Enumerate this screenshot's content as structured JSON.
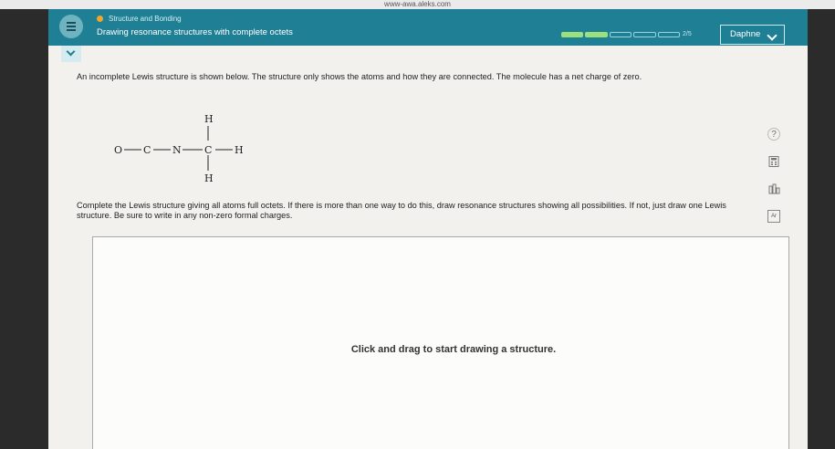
{
  "browser": {
    "url": "www-awa.aleks.com"
  },
  "header": {
    "topic": "Structure and Bonding",
    "lesson": "Drawing resonance structures with complete octets",
    "progress_label": "2/5",
    "progress": {
      "completed": 2,
      "total": 5
    },
    "user_name": "Daphne",
    "accent_color": "#1f7f95"
  },
  "question": {
    "prompt": "An incomplete Lewis structure is shown below. The structure only shows the atoms and how they are connected. The molecule has a net charge of zero.",
    "instructions": "Complete the Lewis structure giving all atoms full octets. If there is more than one way to do this, draw resonance structures showing all possibilities. If not, just draw one Lewis structure. Be sure to write in any non-zero formal charges."
  },
  "molecule": {
    "atoms": [
      "O",
      "C",
      "N",
      "C",
      "H",
      "H",
      "H"
    ]
  },
  "canvas": {
    "hint": "Click and drag to start drawing a structure."
  },
  "side_tools": [
    "help-icon",
    "calculator-icon",
    "chart-icon",
    "periodic-table-icon"
  ],
  "side_table_label": "Ar"
}
